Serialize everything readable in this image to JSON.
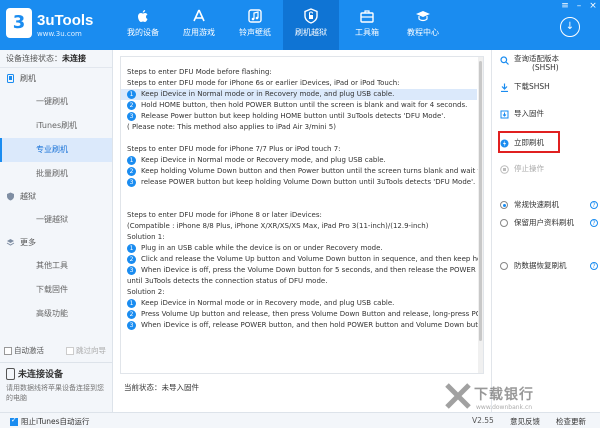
{
  "app": {
    "name": "3uTools",
    "url": "www.3u.com",
    "badge": "3"
  },
  "nav": [
    {
      "label": "我的设备",
      "icon": "apple-icon"
    },
    {
      "label": "应用游戏",
      "icon": "app-store-icon"
    },
    {
      "label": "铃声壁纸",
      "icon": "music-icon"
    },
    {
      "label": "刷机越狱",
      "icon": "jailbreak-icon"
    },
    {
      "label": "工具箱",
      "icon": "toolbox-icon"
    },
    {
      "label": "教程中心",
      "icon": "graduation-cap-icon"
    }
  ],
  "sidebar": {
    "conn_label": "设备连接状态：",
    "conn_value": "未连接",
    "group_flash": "刷机",
    "flash_items": [
      "一键刷机",
      "iTunes刷机",
      "专业刷机",
      "批量刷机"
    ],
    "group_jailbreak": "越狱",
    "jailbreak_items": [
      "一键越狱"
    ],
    "group_more": "更多",
    "more_items": [
      "其他工具",
      "下载固件",
      "高级功能"
    ],
    "auto_activate": "自动激活",
    "skip_guide": "跳过向导",
    "device_title": "未连接设备",
    "device_desc": "请用数据线将苹果设备连接到您的电脑"
  },
  "content": {
    "s1_title": "Steps to enter DFU Mode before flashing:",
    "s1_sub": "Steps to enter DFU mode for iPhone 6s or earlier iDevices, iPad or iPod Touch:",
    "s1_steps": [
      "Keep iDevice in Normal mode or in Recovery mode, and plug USB cable.",
      "Hold HOME button, then hold POWER Button until the screen is blank and wait for 4 seconds.",
      "Release Power button but keep holding HOME button until 3uTools detects 'DFU Mode'."
    ],
    "s1_note": "( Please note: This method also applies to iPad Air 3/mini 5)",
    "s2_sub": "Steps to enter DFU mode for iPhone 7/7 Plus or iPod touch 7:",
    "s2_steps": [
      "Keep iDevice in Normal mode or Recovery mode, and plug USB cable.",
      "Keep holding Volume Down button and then Power button until the screen turns blank and wait for 4 second",
      "release POWER button but keep holding Volume Down button until 3uTools detects 'DFU Mode'."
    ],
    "s3_sub": "Steps to enter DFU mode for iPhone 8 or later iDevices:",
    "s3_compat": "(Compatible : iPhone 8/8 Plus, iPhone X/XR/XS/XS Max, iPad Pro 3(11-inch)/(12.9-inch)",
    "sol1": "Solution 1:",
    "sol1_steps": [
      "Plug in an USB cable while the device is on or under Recovery mode.",
      "Click and release the Volume Up button and Volume Down button in sequence, and then keep holding the PO",
      "When iDevice is off, press the Volume Down button for 5 seconds, and then release the POWER button but do"
    ],
    "sol1_cont": "until 3uTools detects the connection status of DFU mode.",
    "sol2": "Solution 2:",
    "sol2_steps": [
      "Keep iDevice in Normal mode or in Recovery mode, and plug USB cable.",
      "Press Volume Up button and release, then press Volume Down Button and release, long-press POWER button.",
      "When iDevice is off, release POWER button, and then hold POWER button and Volume Down button for 5 secor"
    ],
    "status_label": "当前状态：",
    "status_value": "未导入固件"
  },
  "right": {
    "query_shsh_1": "查询适配版本",
    "query_shsh_2": "(SHSH)",
    "download_shsh": "下载SHSH",
    "import_firmware": "导入固件",
    "flash_now": "立即刷机",
    "stop": "停止操作",
    "modes": [
      "常规快速刷机",
      "保留用户资料刷机",
      "防数据恢复刷机"
    ],
    "selected_mode": 0,
    "highlight_color": "#e02020"
  },
  "footer": {
    "block_itunes": "阻止iTunes自动运行",
    "version": "V2.55",
    "feedback": "意见反馈",
    "update": "检查更新"
  },
  "watermark": {
    "text": "下载银行",
    "url": "www.downbank.cn"
  },
  "colors": {
    "primary": "#1a8cf0",
    "nav_active": "#0f74d4"
  }
}
